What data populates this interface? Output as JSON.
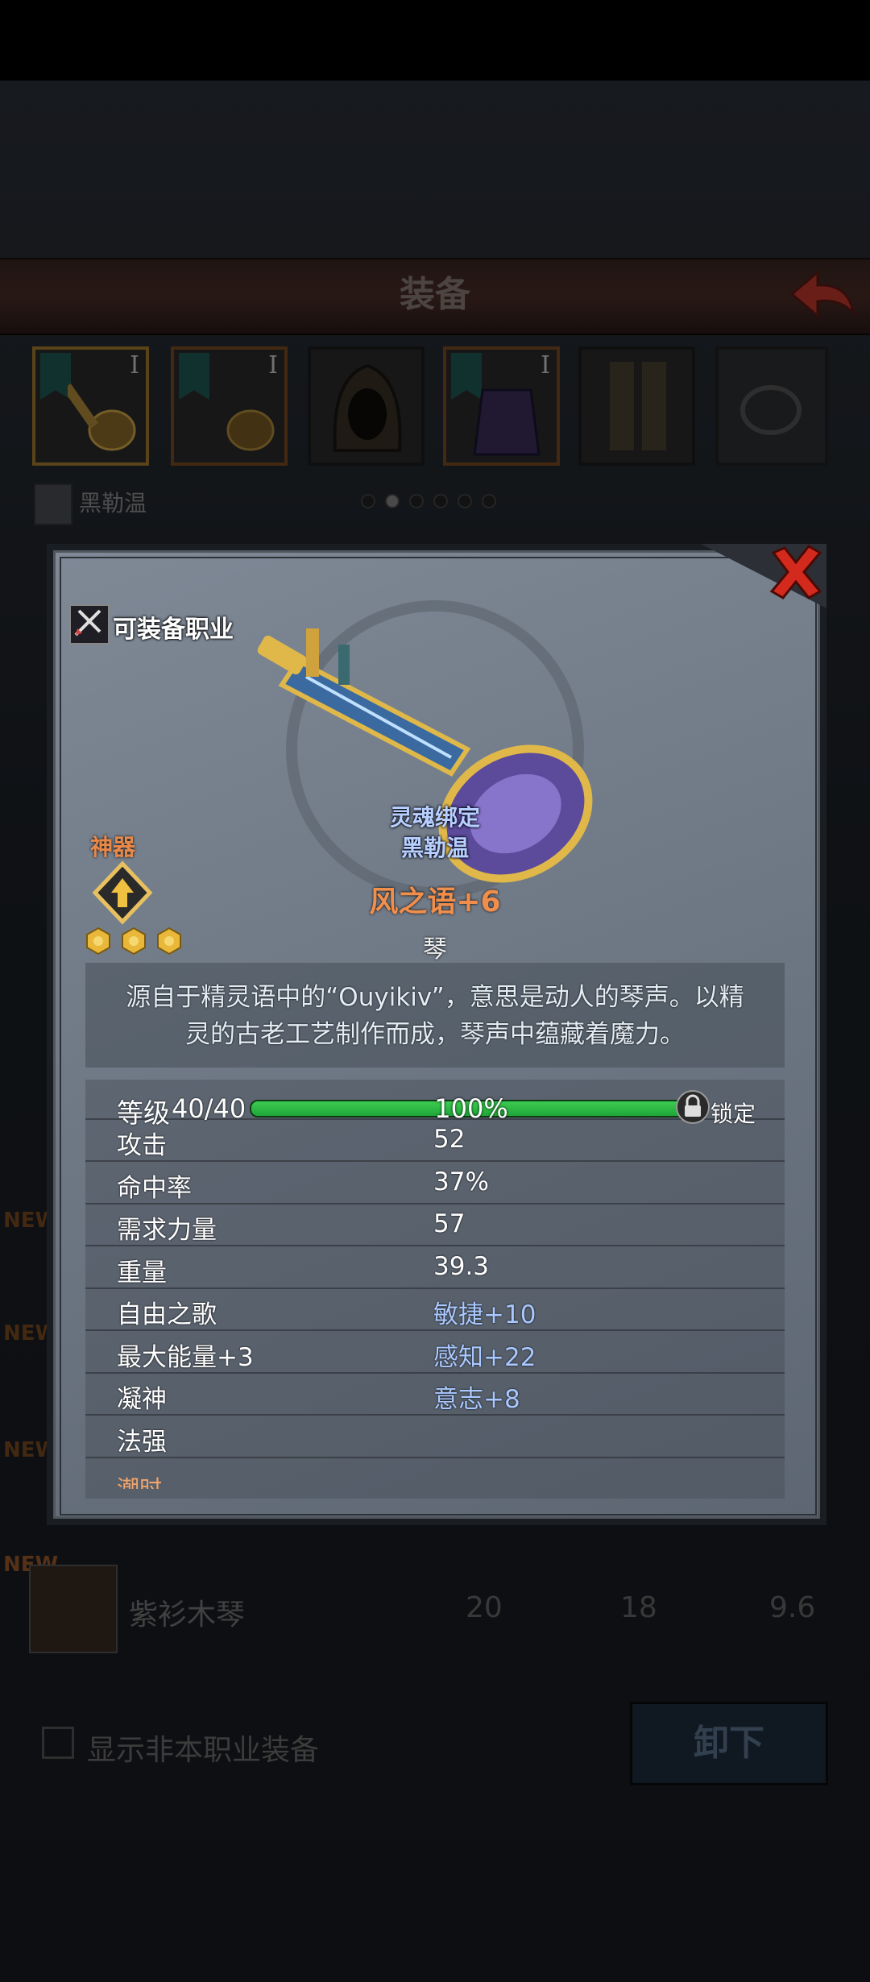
{
  "header": {
    "title": "装备"
  },
  "equipment_slots": [
    {
      "roman": "I",
      "selected": true
    },
    {
      "roman": "I"
    },
    {
      "roman": ""
    },
    {
      "roman": "I"
    },
    {
      "roman": ""
    },
    {
      "roman": ""
    }
  ],
  "character": {
    "name": "黑勒温"
  },
  "pager": {
    "count": 6,
    "active": 1
  },
  "modal": {
    "class_label": "可装备职业",
    "rarity_label": "神器",
    "soulbind_line1": "灵魂绑定",
    "soulbind_line2": "黑勒温",
    "weapon_name": "风之语+6",
    "weapon_type": "琴",
    "description": "源自于精灵语中的“Ouyikiv”，意思是动人的琴声。以精灵的古老工艺制作而成，琴声中蕴藏着魔力。",
    "level_label": "等级",
    "level_value": "40/40",
    "progress_text": "100%",
    "progress": 1.0,
    "lock_label": "锁定",
    "stats": [
      {
        "label": "攻击",
        "value": "52"
      },
      {
        "label": "命中率",
        "value": "37%"
      },
      {
        "label": "需求力量",
        "value": "57"
      },
      {
        "label": "重量",
        "value": "39.3"
      },
      {
        "label": "自由之歌",
        "value_blue": "敏捷",
        "value_rest": "+10"
      },
      {
        "label": "最大能量+3",
        "value_blue": "感知",
        "value_rest": "+22"
      },
      {
        "label": "凝神",
        "value_blue": "意志",
        "value_rest": "+8"
      },
      {
        "label": "法强",
        "value": ""
      }
    ],
    "cut_row": "潮时"
  },
  "list": {
    "new_badge": "NEW",
    "item_name": "紫衫木琴",
    "values": [
      "20",
      "18",
      "9.6"
    ]
  },
  "footer": {
    "show_label": "显示非本职业装备",
    "unequip_label": "卸下"
  },
  "colors": {
    "accent": "#f08e4c",
    "bar": "#2fbf45",
    "blue_stat": "#a9c8ff"
  }
}
